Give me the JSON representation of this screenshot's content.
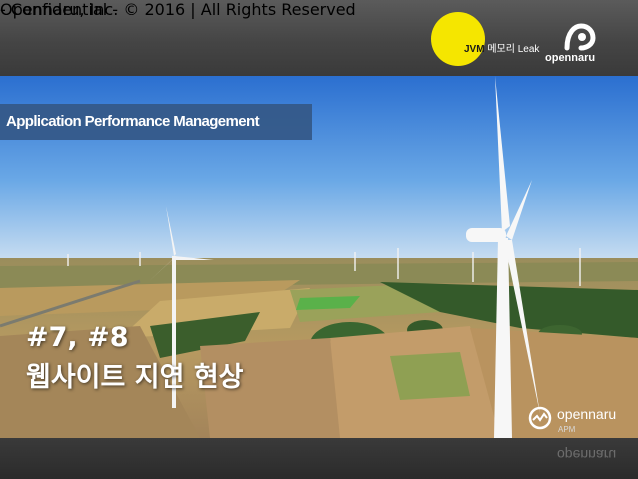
{
  "header": {
    "title_jvm": "JVM",
    "title_rest": " 메모리 Leak",
    "logo_text": "opennaru"
  },
  "banner": {
    "label": "Application Performance Management"
  },
  "headline": {
    "line1": "#7, #8",
    "line2": "웹사이트 지연 현상"
  },
  "badge": {
    "name": "opennaru",
    "sub": "APM"
  },
  "footer": {
    "confidential": "- Confidential -",
    "copyright": "Opennaru, Inc. ©  2016 | All Rights Reserved"
  },
  "colors": {
    "accent_yellow": "#f5e600",
    "band_blue": "#345887"
  }
}
